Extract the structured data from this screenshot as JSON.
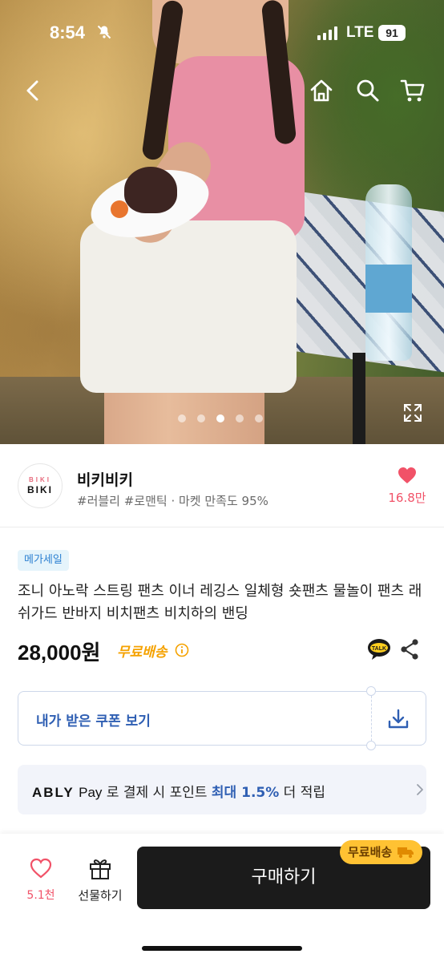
{
  "status_bar": {
    "time": "8:54",
    "network": "LTE",
    "battery": "91"
  },
  "icons": {
    "back": "chevron-left-icon",
    "home": "home-icon",
    "search": "search-icon",
    "cart": "cart-icon",
    "expand": "expand-icon",
    "heart": "heart-icon",
    "info": "info-icon",
    "talk": "kakao-talk-icon",
    "share": "share-icon",
    "download": "download-icon",
    "chevron": "chevron-right-icon",
    "gift": "gift-icon",
    "truck": "truck-icon",
    "bell_muted": "bell-slash-icon"
  },
  "gallery": {
    "total_images": 5,
    "active_index": 3
  },
  "seller": {
    "logo_top": "BIKI",
    "logo_bottom": "BIKI",
    "name": "비키비키",
    "tags": "#러블리 #로맨틱 · 마켓 만족도 95%",
    "likes": "16.8만"
  },
  "product": {
    "badge": "메가세일",
    "title": "조니 아노락 스트링 팬츠 이너 레깅스 일체형 숏팬츠 물놀이 팬츠 래쉬가드 반바지 비치팬츠 비치하의 밴딩",
    "price": "28,000원",
    "shipping": "무료배송"
  },
  "coupon": {
    "label": "내가 받은 쿠폰 보기"
  },
  "ably_pay": {
    "brand": "ABLY",
    "pay": "Pay",
    "text_before": " 로 결제 시 포인트 ",
    "highlight": "최대 1.5%",
    "text_after": " 더 적립"
  },
  "bottom_bar": {
    "wishlist_count": "5.1천",
    "gift_label": "선물하기",
    "buy_label": "구매하기",
    "free_ship_badge": "무료배송"
  },
  "colors": {
    "accent_pink": "#f15268",
    "coupon_blue": "#2f5fb3",
    "ship_orange": "#f5a200",
    "buy_black": "#1b1b1b",
    "badge_yellow": "#ffc233"
  }
}
